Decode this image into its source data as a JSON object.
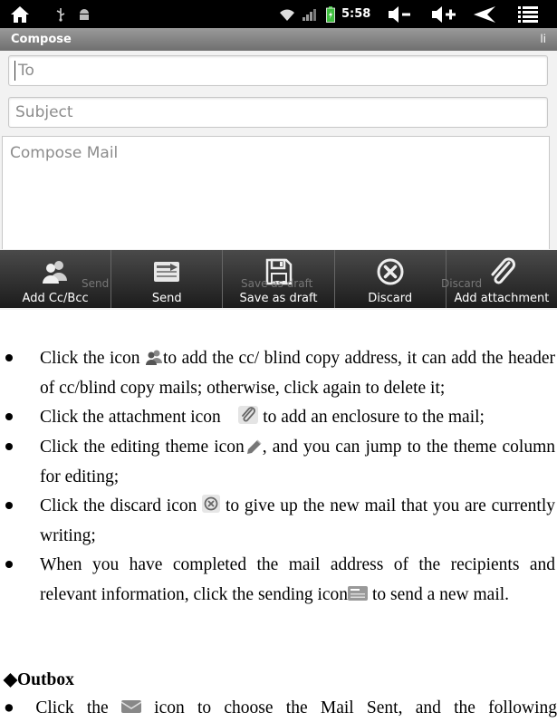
{
  "status_bar": {
    "time": "5:58",
    "icons": [
      "home-icon",
      "usb-icon",
      "android-debug-icon",
      "wifi-icon",
      "signal-icon",
      "battery-icon",
      "volume-down-icon",
      "volume-up-icon",
      "back-icon",
      "menu-icon"
    ]
  },
  "compose": {
    "title": "Compose",
    "title_right": "li",
    "to_placeholder": "To",
    "subject_placeholder": "Subject",
    "body_placeholder": "Compose Mail",
    "ghost_labels": [
      "Send",
      "Save as draft",
      "Discard"
    ]
  },
  "actions": [
    {
      "label": "Add Cc/Bcc",
      "icon": "add-contacts-icon"
    },
    {
      "label": "Send",
      "icon": "send-icon"
    },
    {
      "label": "Save as draft",
      "icon": "save-draft-icon"
    },
    {
      "label": "Discard",
      "icon": "discard-icon"
    },
    {
      "label": "Add attachment",
      "icon": "paperclip-icon"
    }
  ],
  "doc": {
    "b1_a": "Click the icon ",
    "b1_b": "to add the cc/ blind copy address, it can add the header of cc/blind copy mails; otherwise, click again to delete it;",
    "b2_a": "Click the attachment icon ",
    "b2_b": " to add an enclosure to the mail;",
    "b3_a": "Click the editing theme icon",
    "b3_b": ", and you can jump to the theme column for editing;",
    "b4_a": "Click the discard icon ",
    "b4_b": " to give up the new mail that you are currently writing;",
    "b5_a": "When you have completed the mail address of the recipients and relevant information, click the sending icon",
    "b5_b": " to send a new mail.",
    "outbox_heading": "◆Outbox",
    "last_a": "● Click the ",
    "last_b": " icon to choose the Mail Sent, and the following"
  },
  "colors": {
    "status_bar": "#000000",
    "title_bar": "#7e7e7e",
    "action_bar": "#2e2e2e",
    "battery": "#3fbf3f"
  }
}
